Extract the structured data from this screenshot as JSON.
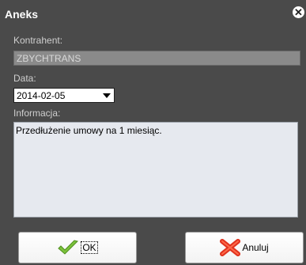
{
  "window": {
    "title": "Aneks",
    "close_icon": "close-icon"
  },
  "form": {
    "kontrahent_label": "Kontrahent:",
    "kontrahent_value": "ZBYCHTRANS",
    "data_label": "Data:",
    "data_value": "2014-02-05",
    "informacja_label": "Informacja:",
    "informacja_value": "Przedłużenie umowy na 1 miesiąc."
  },
  "buttons": {
    "ok_label": "OK",
    "ok_icon": "checkmark-icon",
    "cancel_label": "Anuluj",
    "cancel_icon": "red-x-icon"
  },
  "colors": {
    "background": "#4a4a4a",
    "checkmark": "#7cc23c",
    "cancel_x": "#e0331f"
  }
}
